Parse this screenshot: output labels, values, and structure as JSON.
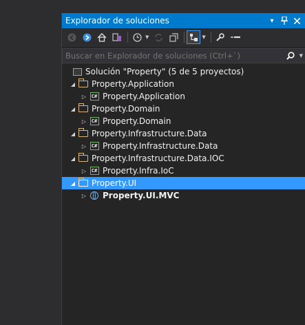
{
  "panel": {
    "title": "Explorador de soluciones",
    "title_icons": [
      "dropdown-arrow-icon",
      "pin-icon",
      "close-icon"
    ]
  },
  "toolbar": {
    "buttons": [
      "back-icon",
      "forward-icon",
      "home-icon",
      "switch-views-icon",
      "history-icon",
      "sync-icon",
      "collapse-all-icon",
      "show-all-files-icon",
      "properties-icon",
      "preview-icon"
    ]
  },
  "search": {
    "placeholder": "Buscar en Explorador de soluciones (Ctrl+`)"
  },
  "tree": {
    "solution": "Solución \"Property\" (5 de 5 proyectos)",
    "items": [
      {
        "folder": "Property.Application",
        "project": "Property.Application",
        "project_type": "csharp"
      },
      {
        "folder": "Property.Domain",
        "project": "Property.Domain",
        "project_type": "csharp"
      },
      {
        "folder": "Property.Infrastructure.Data",
        "project": "Property.Infrastructure.Data",
        "project_type": "csharp"
      },
      {
        "folder": "Property.Infrastructure.Data.IOC",
        "project": "Property.Infra.IoC",
        "project_type": "csharp"
      },
      {
        "folder": "Property.UI",
        "project": "Property.UI.MVC",
        "project_type": "web"
      }
    ],
    "selected": "Property.UI"
  },
  "colors": {
    "accent": "#007acc",
    "selection": "#3399ff",
    "background": "#252526",
    "folder": "#dcb67a",
    "csharp": "#6dbb5a"
  }
}
